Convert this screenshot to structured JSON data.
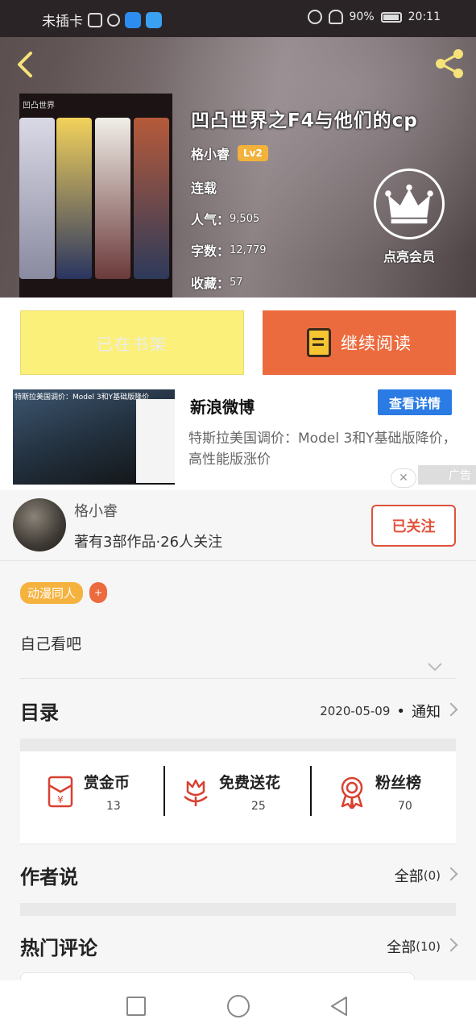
{
  "status_bar": {
    "carrier": "未插卡",
    "battery": "90%",
    "time": "20:11"
  },
  "header": {
    "back_icon": "chevron-left-icon",
    "share_icon": "share-icon"
  },
  "book": {
    "title": "凹凸世界之F4与他们的cp",
    "author": "格小睿",
    "level": "Lv2",
    "status": "连载",
    "popularity_label": "人气：",
    "popularity": "9,505",
    "words_label": "字数：",
    "words": "12,779",
    "favorites_label": "收藏：",
    "favorites": "57",
    "cover_text": "凹凸世界"
  },
  "vip": {
    "icon": "crown-icon",
    "label": "点亮会员"
  },
  "actions": {
    "shelf_label": "已在书架",
    "read_label": "继续阅读"
  },
  "ad": {
    "image_caption": "特斯拉美国调价：Model 3和Y基础版降价",
    "source": "新浪微博",
    "detail_label": "查看详情",
    "description": "特斯拉美国调价：Model 3和Y基础版降价，高性能版涨价",
    "close_label": "✕",
    "tag": "广告"
  },
  "author": {
    "name": "格小睿",
    "stats": "著有3部作品·26人关注",
    "follow_label": "已关注"
  },
  "tags": {
    "items": [
      "动漫同人"
    ],
    "plus": "+"
  },
  "summary": "自己看吧",
  "catalog": {
    "title": "目录",
    "date": "2020-05-09",
    "dot": "•",
    "notice": "通知"
  },
  "gifts": [
    {
      "label": "赏金币",
      "count": "13",
      "icon": "red-envelope-icon"
    },
    {
      "label": "免费送花",
      "count": "25",
      "icon": "flower-icon"
    },
    {
      "label": "粉丝榜",
      "count": "70",
      "icon": "medal-icon"
    }
  ],
  "author_says": {
    "title": "作者说",
    "all_label": "全部",
    "count": "(0)"
  },
  "hot_comments": {
    "title": "热门评论",
    "all_label": "全部",
    "count": "(10)"
  },
  "colors": {
    "accent": "#ec6b3e",
    "shelf": "#fbf07a",
    "tag": "#f6b23e",
    "follow": "#e0523a",
    "ad_button": "#2b7be4"
  }
}
